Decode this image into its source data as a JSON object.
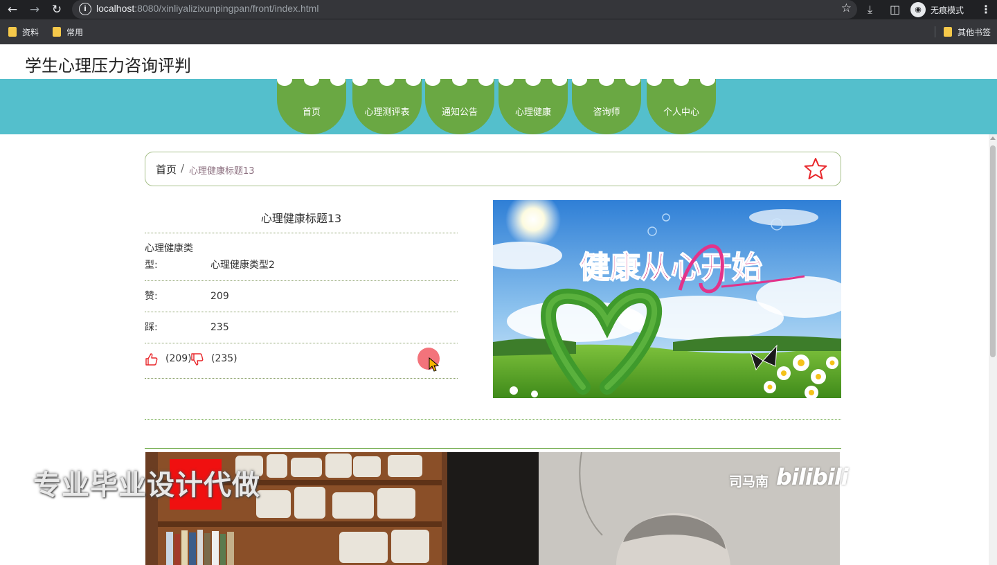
{
  "browser": {
    "url_host": "localhost",
    "url_rest": ":8080/xinliyalizixunpingpan/front/index.html",
    "incognito_label": "无痕模式",
    "bookmarks": [
      "资料",
      "常用"
    ],
    "other_bookmarks": "其他书签"
  },
  "site": {
    "title": "学生心理压力咨询评判",
    "nav": [
      "首页",
      "心理测评表",
      "通知公告",
      "心理健康",
      "咨询师",
      "个人中心"
    ]
  },
  "breadcrumb": {
    "home": "首页",
    "separator": "/",
    "current": "心理健康标题13"
  },
  "detail": {
    "title": "心理健康标题13",
    "fields": [
      {
        "label_line1": "心理健康类",
        "label_line2": "型:",
        "value": "心理健康类型2"
      },
      {
        "label": "赞:",
        "value": "209"
      },
      {
        "label": "踩:",
        "value": "235"
      }
    ],
    "likes": "(209)",
    "dislikes": "(235)"
  },
  "hero_image": {
    "caption": "健康从心开始"
  },
  "video": {
    "watermark": "专业毕业设计代做",
    "channel": "司马南",
    "platform": "bilibili"
  },
  "colors": {
    "nav_bar": "#54bfcc",
    "nav_item": "#6aa843",
    "chrome": "#202124"
  }
}
